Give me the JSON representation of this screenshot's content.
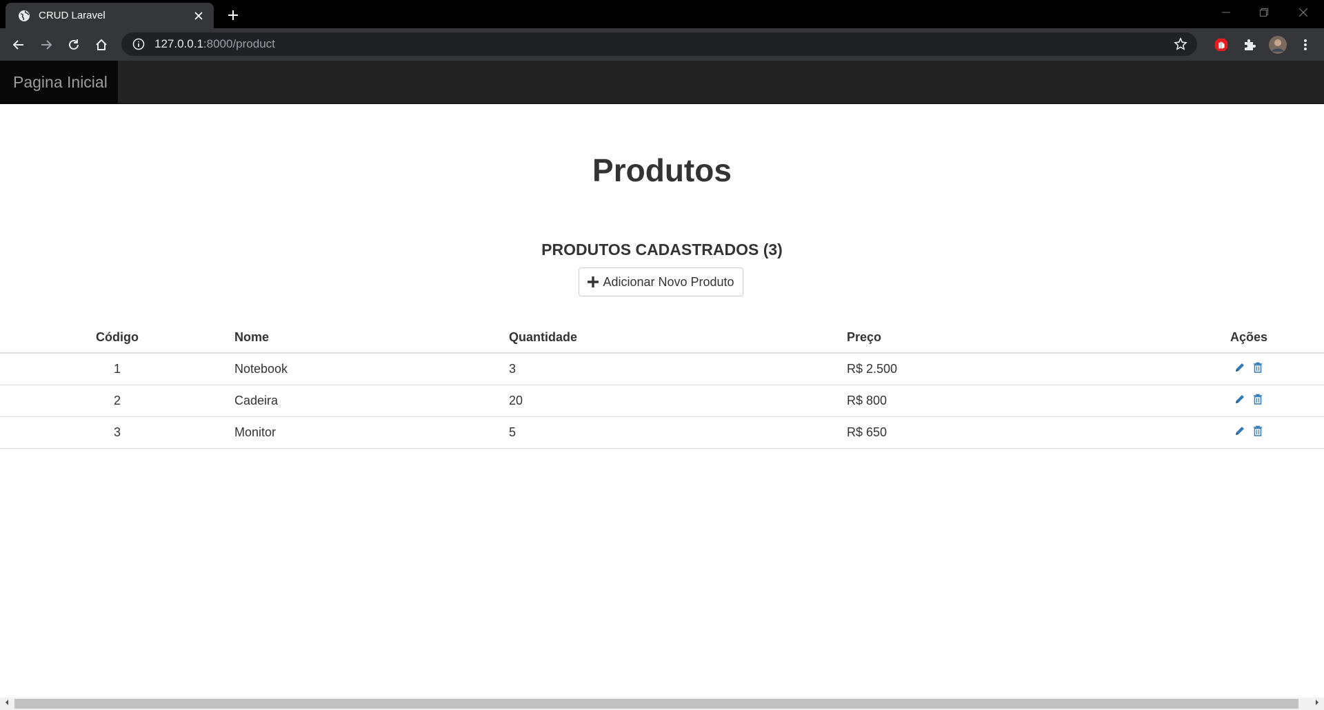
{
  "browser": {
    "tab_title": "CRUD Laravel",
    "url_host": "127.0.0.1",
    "url_path": ":8000/product",
    "icons": {
      "tab": "globe-icon",
      "close": "close-icon",
      "new_tab": "plus-icon",
      "back": "back-arrow-icon",
      "forward": "forward-arrow-icon",
      "reload": "reload-icon",
      "home": "home-icon",
      "site_info": "info-icon",
      "bookmark": "star-icon",
      "ext_adblock": "adblock-icon",
      "extensions": "puzzle-icon",
      "profile": "avatar",
      "menu": "kebab-menu-icon"
    }
  },
  "navbar": {
    "brand": "Pagina Inicial"
  },
  "page": {
    "title": "Produtos",
    "subtitle": "PRODUTOS CADASTRADOS (3)",
    "add_button": "Adicionar Novo Produto"
  },
  "table": {
    "headers": [
      "Código",
      "Nome",
      "Quantidade",
      "Preço",
      "Ações"
    ],
    "rows": [
      {
        "codigo": "1",
        "nome": "Notebook",
        "quantidade": "3",
        "preco": "R$ 2.500"
      },
      {
        "codigo": "2",
        "nome": "Cadeira",
        "quantidade": "20",
        "preco": "R$ 800"
      },
      {
        "codigo": "3",
        "nome": "Monitor",
        "quantidade": "5",
        "preco": "R$ 650"
      }
    ]
  },
  "colors": {
    "action_icon": "#337ab7",
    "navbar_bg": "#222222",
    "brand_bg": "#080808"
  }
}
